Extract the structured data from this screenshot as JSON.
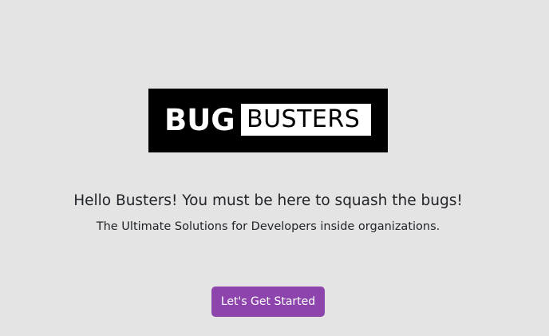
{
  "logo": {
    "word_1": "BUG",
    "word_2": "BUSTERS"
  },
  "hero": {
    "heading": "Hello Busters! You must be here to squash the bugs!",
    "subheading": "The Ultimate Solutions for Developers inside organizations."
  },
  "cta": {
    "label": "Let's Get Started"
  },
  "colors": {
    "background": "#e4e4e4",
    "logo_background": "#000000",
    "button": "#8e44ad"
  }
}
